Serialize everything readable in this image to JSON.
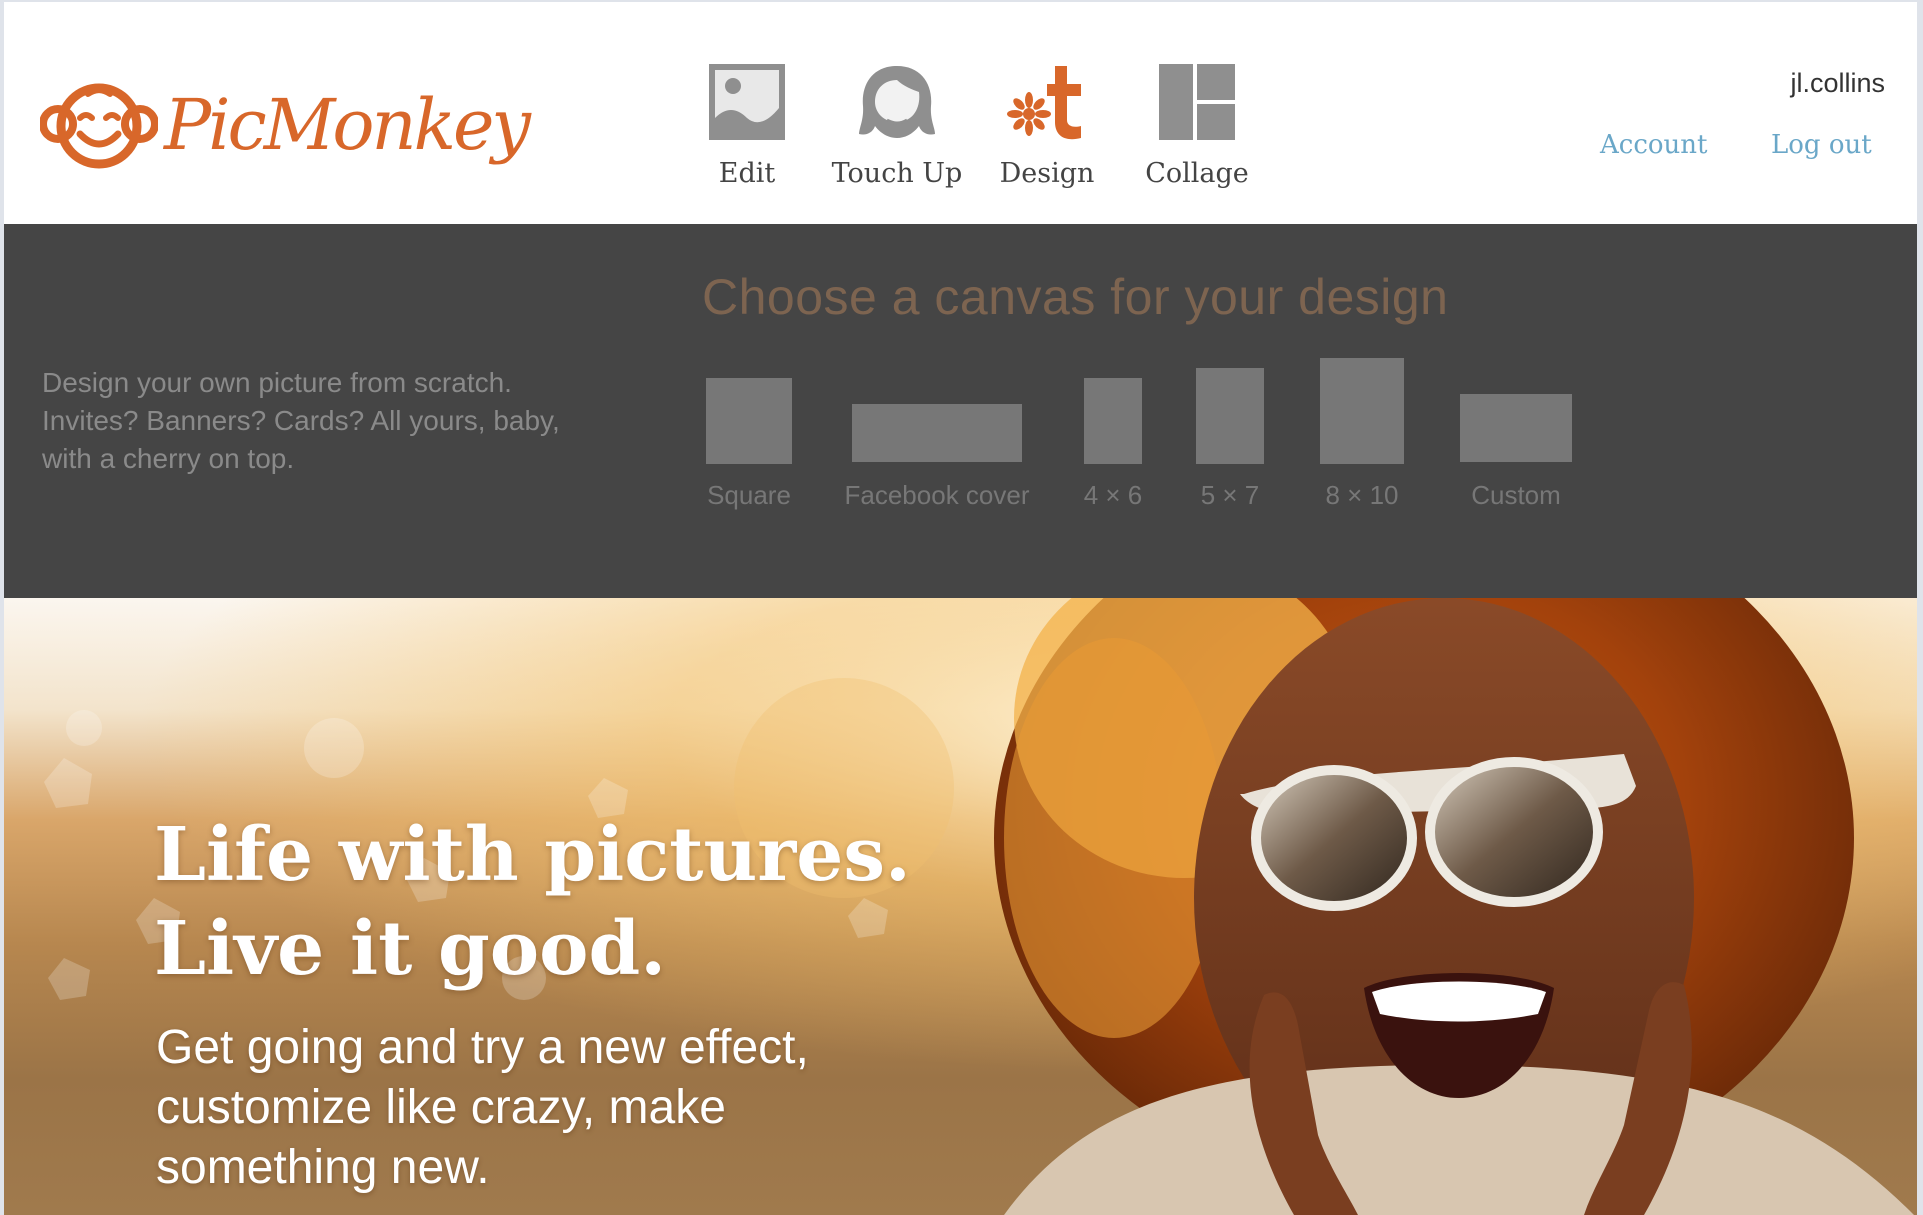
{
  "brand": {
    "name": "PicMonkey",
    "color": "#d8672a"
  },
  "nav": [
    {
      "label": "Edit",
      "icon": "image-icon"
    },
    {
      "label": "Touch Up",
      "icon": "face-icon"
    },
    {
      "label": "Design",
      "icon": "design-icon"
    },
    {
      "label": "Collage",
      "icon": "collage-icon"
    }
  ],
  "user": {
    "name": "jl.collins",
    "account_label": "Account",
    "logout_label": "Log out",
    "link_color": "#6aa7c8"
  },
  "design": {
    "description": "Design your own picture from scratch. Invites? Banners? Cards? All yours, baby, with a cherry on top.",
    "heading": "Choose a canvas for your design",
    "canvases": [
      {
        "label": "Square"
      },
      {
        "label": "Facebook cover"
      },
      {
        "label": "4 × 6"
      },
      {
        "label": "5 × 7"
      },
      {
        "label": "8 × 10"
      },
      {
        "label": "Custom"
      }
    ]
  },
  "hero": {
    "title_line1": "Life with pictures.",
    "title_line2": "Live it good.",
    "subtitle": "Get going and try a new effect, customize like crazy, make something new."
  }
}
